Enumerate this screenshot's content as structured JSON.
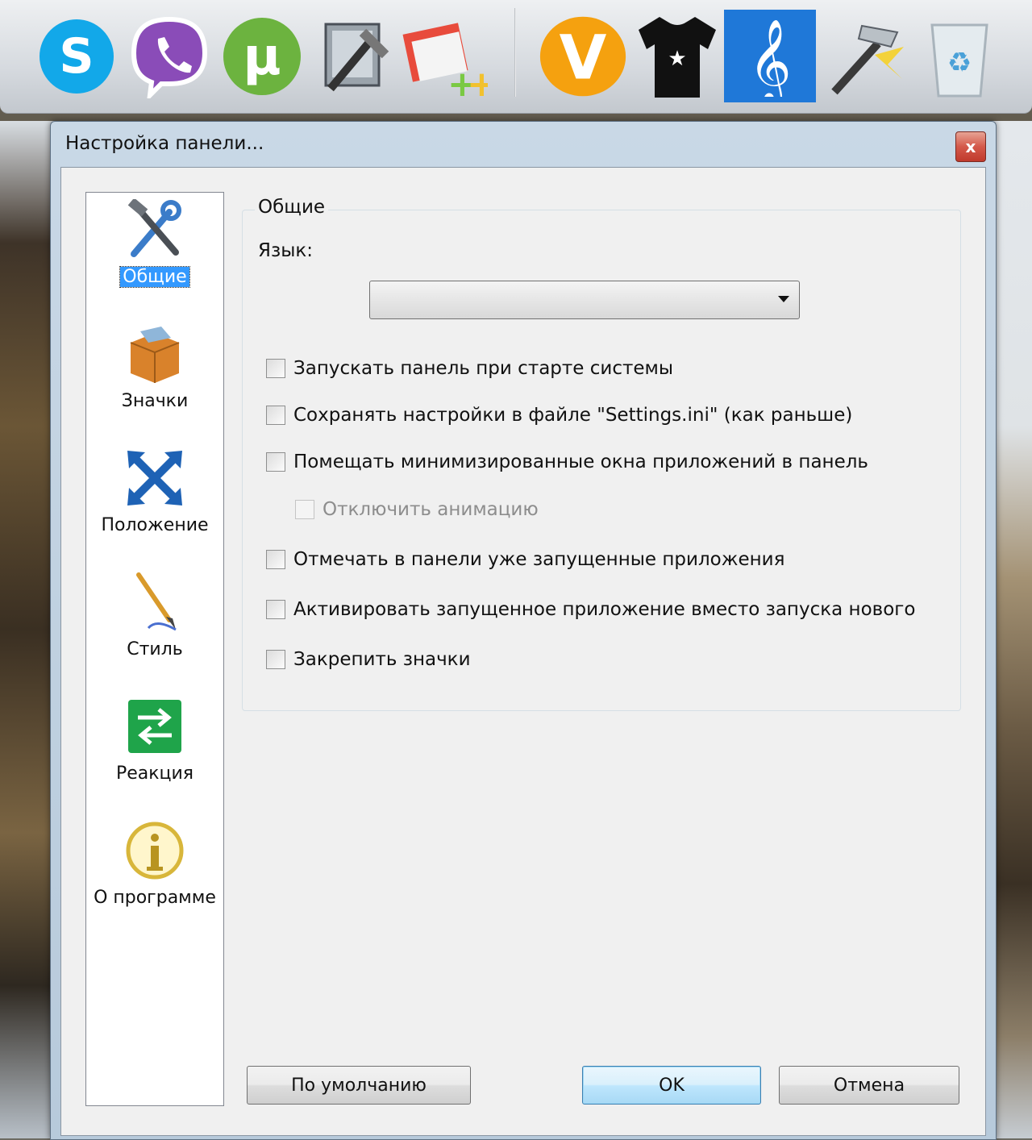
{
  "dock": {
    "icons": [
      "skype-icon",
      "viber-icon",
      "utorrent-icon",
      "tools-icon",
      "notepad-plus-icon",
      "v-app-icon",
      "tshirt-icon",
      "music-note-icon",
      "hammer-icon",
      "recycle-bin-icon"
    ]
  },
  "window": {
    "title": "Настройка панели...",
    "close_label": "x"
  },
  "sidebar": {
    "items": [
      {
        "label": "Общие",
        "icon": "tools-icon",
        "selected": true
      },
      {
        "label": "Значки",
        "icon": "box-icon"
      },
      {
        "label": "Положение",
        "icon": "move-arrows-icon"
      },
      {
        "label": "Стиль",
        "icon": "brush-icon"
      },
      {
        "label": "Реакция",
        "icon": "arrows-exchange-icon"
      },
      {
        "label": "О программе",
        "icon": "info-icon"
      }
    ]
  },
  "general": {
    "group_title": "Общие",
    "language_label": "Язык:",
    "language_value": "",
    "options": [
      {
        "label": "Запускать панель при старте системы",
        "checked": false
      },
      {
        "label": "Сохранять настройки в файле \"Settings.ini\" (как раньше)",
        "checked": false
      },
      {
        "label": "Помещать минимизированные окна приложений в панель",
        "checked": false
      },
      {
        "label": "Отключить анимацию",
        "checked": false,
        "disabled": true
      },
      {
        "label": "Отмечать в панели уже запущенные приложения",
        "checked": false
      },
      {
        "label": "Активировать запущенное приложение вместо запуска нового",
        "checked": false
      },
      {
        "label": "Закрепить значки",
        "checked": false
      }
    ]
  },
  "buttons": {
    "defaults": "По умолчанию",
    "ok": "OK",
    "cancel": "Отмена"
  }
}
